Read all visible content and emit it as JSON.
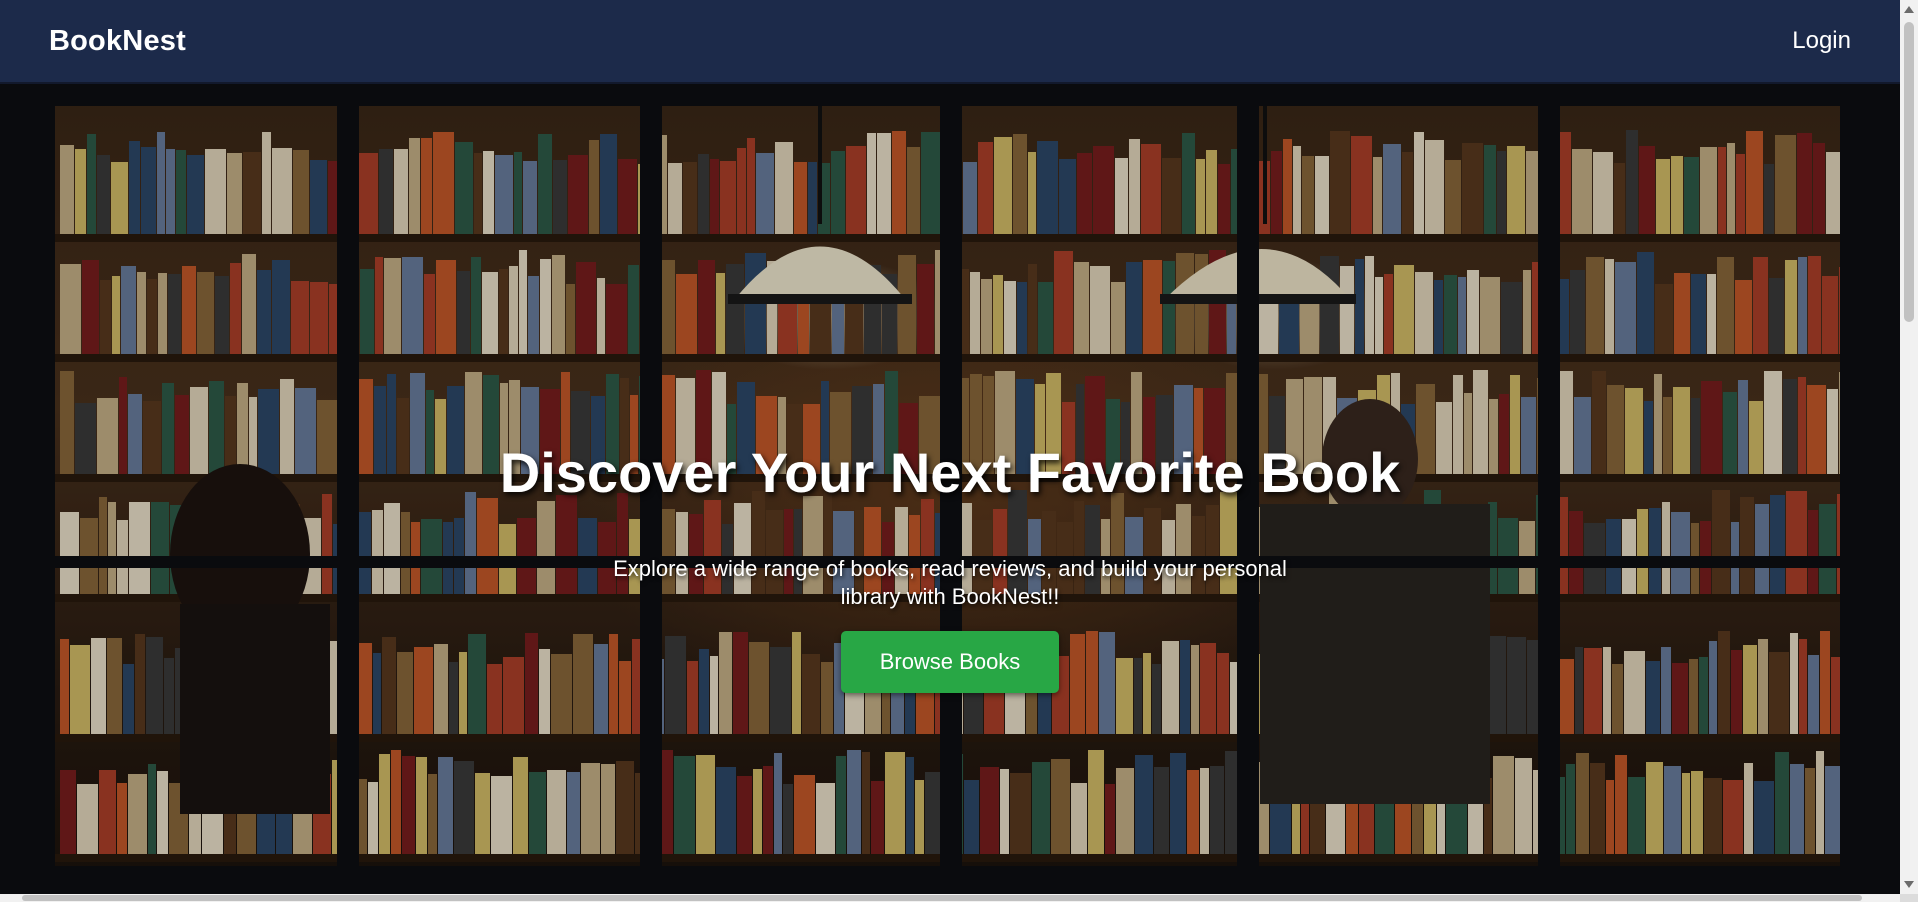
{
  "navbar": {
    "brand": "BookNest",
    "login_label": "Login"
  },
  "hero": {
    "image_description": "Bookshop window with shelves of books behind black window frames, pendant lamps, and people browsing",
    "title": "Discover Your Next Favorite Book",
    "subtitle": "Explore a wide range of books, read reviews, and build your personal library with BookNest!!",
    "cta_label": "Browse Books"
  },
  "colors": {
    "navbar_bg": "#1c2a4a",
    "cta_bg": "#28a745",
    "text": "#ffffff"
  }
}
